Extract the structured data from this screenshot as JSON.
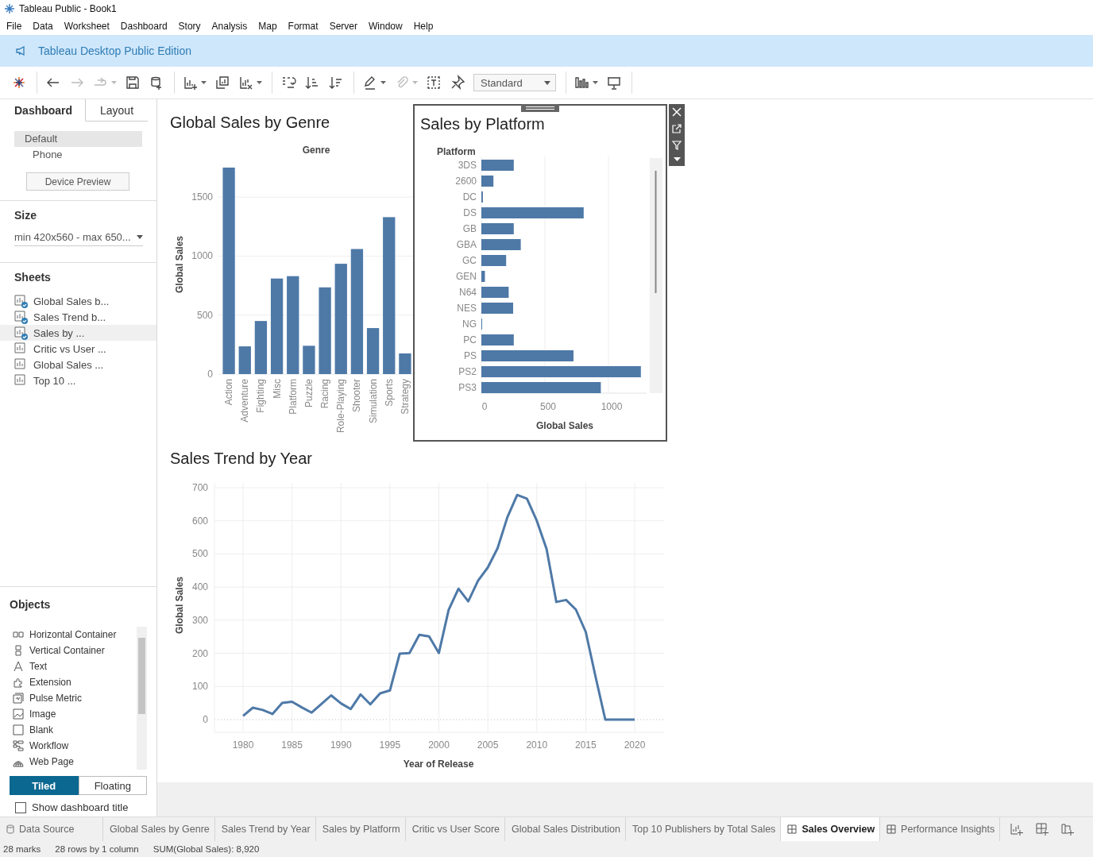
{
  "window": {
    "title": "Tableau Public - Book1"
  },
  "menu": [
    "File",
    "Data",
    "Worksheet",
    "Dashboard",
    "Story",
    "Analysis",
    "Map",
    "Format",
    "Server",
    "Window",
    "Help"
  ],
  "banner": {
    "text": "Tableau Desktop Public Edition"
  },
  "toolbar": {
    "groups": [
      [
        {
          "kind": "logo",
          "disabled": false,
          "menu": false
        }
      ],
      [
        {
          "kind": "back",
          "disabled": false,
          "menu": false
        },
        {
          "kind": "forward",
          "disabled": true,
          "menu": false
        },
        {
          "kind": "run",
          "disabled": true,
          "menu": true
        },
        {
          "kind": "save",
          "disabled": false,
          "menu": false
        },
        {
          "kind": "datasource",
          "disabled": false,
          "menu": false
        }
      ],
      [
        {
          "kind": "new-sheet",
          "disabled": false,
          "menu": true
        },
        {
          "kind": "duplicate",
          "disabled": false,
          "menu": false
        },
        {
          "kind": "clear",
          "disabled": false,
          "menu": true
        }
      ],
      [
        {
          "kind": "swap",
          "disabled": false,
          "menu": false
        },
        {
          "kind": "sort-asc",
          "disabled": false,
          "menu": false
        },
        {
          "kind": "sort-desc",
          "disabled": false,
          "menu": false
        }
      ],
      [
        {
          "kind": "highlight",
          "disabled": false,
          "menu": true
        },
        {
          "kind": "attach",
          "disabled": true,
          "menu": true
        },
        {
          "kind": "label",
          "disabled": false,
          "menu": false
        },
        {
          "kind": "pin",
          "disabled": false,
          "menu": false
        },
        {
          "kind": "fit",
          "disabled": false,
          "menu": false,
          "value": "Standard"
        }
      ],
      [
        {
          "kind": "show-me",
          "disabled": false,
          "menu": true
        },
        {
          "kind": "present",
          "disabled": false,
          "menu": false
        }
      ]
    ]
  },
  "side_panel": {
    "tabs": [
      {
        "label": "Dashboard",
        "selected": true
      },
      {
        "label": "Layout",
        "selected": false
      }
    ],
    "devices": [
      {
        "label": "Default",
        "selected": true
      },
      {
        "label": "Phone",
        "selected": false
      }
    ],
    "device_preview_button": "Device Preview",
    "size": {
      "heading": "Size",
      "value": "min 420x560 - max 650..."
    },
    "sheets": {
      "heading": "Sheets",
      "items": [
        {
          "label": "Global Sales b...",
          "used": true,
          "selected": false
        },
        {
          "label": "Sales Trend b...",
          "used": true,
          "selected": false
        },
        {
          "label": "Sales by ...",
          "used": true,
          "selected": true
        },
        {
          "label": "Critic vs User ...",
          "used": false,
          "selected": false
        },
        {
          "label": "Global Sales ...",
          "used": false,
          "selected": false
        },
        {
          "label": "Top 10 ...",
          "used": false,
          "selected": false
        }
      ]
    },
    "objects": {
      "heading": "Objects",
      "items": [
        {
          "label": "Horizontal Container",
          "kind": "hcontainer"
        },
        {
          "label": "Vertical Container",
          "kind": "vcontainer"
        },
        {
          "label": "Text",
          "kind": "text"
        },
        {
          "label": "Extension",
          "kind": "extension"
        },
        {
          "label": "Pulse Metric",
          "kind": "pulse"
        },
        {
          "label": "Image",
          "kind": "image"
        },
        {
          "label": "Blank",
          "kind": "blank"
        },
        {
          "label": "Workflow",
          "kind": "workflow"
        },
        {
          "label": "Web Page",
          "kind": "web"
        }
      ]
    },
    "layout_modes": [
      {
        "label": "Tiled",
        "selected": true
      },
      {
        "label": "Floating",
        "selected": false
      }
    ],
    "show_title": {
      "label": "Show dashboard title",
      "checked": false
    }
  },
  "dashboard": {
    "genre": {
      "title": "Global Sales by Genre",
      "chart_data": {
        "type": "bar",
        "grid": true,
        "xlabel": "Genre",
        "ylabel": "Global Sales",
        "categories": [
          "Action",
          "Adventure",
          "Fighting",
          "Misc",
          "Platform",
          "Puzzle",
          "Racing",
          "Role-Playing",
          "Shooter",
          "Simulation",
          "Sports",
          "Strategy"
        ],
        "values": [
          1750,
          235,
          450,
          810,
          830,
          240,
          735,
          935,
          1060,
          390,
          1330,
          175
        ],
        "ylim": [
          0,
          1750
        ],
        "yticks": [
          0,
          500,
          1000,
          1500
        ]
      }
    },
    "platform": {
      "title": "Sales by Platform",
      "selected": true,
      "chart_data": {
        "type": "bar",
        "orientation": "horizontal",
        "grid": true,
        "ylabel": "Platform",
        "xlabel": "Global Sales",
        "categories": [
          "3DS",
          "2600",
          "DC",
          "DS",
          "GB",
          "GBA",
          "GC",
          "GEN",
          "N64",
          "NES",
          "NG",
          "PC",
          "PS",
          "PS2",
          "PS3"
        ],
        "values": [
          255,
          95,
          12,
          805,
          255,
          310,
          195,
          28,
          215,
          250,
          1,
          255,
          725,
          1255,
          940
        ],
        "xlim": [
          0,
          1300
        ],
        "xticks": [
          0,
          500,
          1000
        ]
      }
    },
    "trend": {
      "title": "Sales Trend by Year",
      "chart_data": {
        "type": "line",
        "grid": true,
        "xlabel": "Year of Release",
        "ylabel": "Global Sales",
        "x": [
          1980,
          1981,
          1982,
          1983,
          1984,
          1985,
          1986,
          1987,
          1988,
          1989,
          1990,
          1991,
          1992,
          1993,
          1994,
          1995,
          1996,
          1997,
          1998,
          1999,
          2000,
          2001,
          2002,
          2003,
          2004,
          2005,
          2006,
          2007,
          2008,
          2009,
          2010,
          2011,
          2012,
          2013,
          2014,
          2015,
          2016,
          2017,
          2018,
          2019,
          2020
        ],
        "values": [
          11,
          36,
          29,
          17,
          50,
          54,
          37,
          21,
          47,
          73,
          49,
          32,
          76,
          46,
          79,
          88,
          199,
          201,
          256,
          251,
          201,
          331,
          395,
          357,
          419,
          459,
          517,
          611,
          678,
          667,
          600,
          515,
          355,
          361,
          332,
          265,
          130,
          0,
          0,
          0,
          0
        ],
        "xlim": [
          1980,
          2020
        ],
        "ylim": [
          0,
          700
        ],
        "xticks": [
          1980,
          1985,
          1990,
          1995,
          2000,
          2005,
          2010,
          2015,
          2020
        ],
        "yticks": [
          0,
          100,
          200,
          300,
          400,
          500,
          600,
          700
        ]
      }
    }
  },
  "sheet_tabs": [
    {
      "label": "Data Source",
      "kind": "datasource",
      "selected": false
    },
    {
      "label": "Global Sales by Genre",
      "kind": "sheet",
      "selected": false
    },
    {
      "label": "Sales Trend by Year",
      "kind": "sheet",
      "selected": false
    },
    {
      "label": "Sales by Platform",
      "kind": "sheet",
      "selected": false
    },
    {
      "label": "Critic vs User Score",
      "kind": "sheet",
      "selected": false
    },
    {
      "label": "Global Sales Distribution",
      "kind": "sheet",
      "selected": false
    },
    {
      "label": "Top 10 Publishers by Total Sales",
      "kind": "sheet",
      "selected": false
    },
    {
      "label": "Sales Overview",
      "kind": "dashboard",
      "selected": true
    },
    {
      "label": "Performance Insights",
      "kind": "dashboard",
      "selected": false
    }
  ],
  "status_bar": [
    "28 marks",
    "28 rows by 1 column",
    "SUM(Global Sales): 8,920"
  ]
}
